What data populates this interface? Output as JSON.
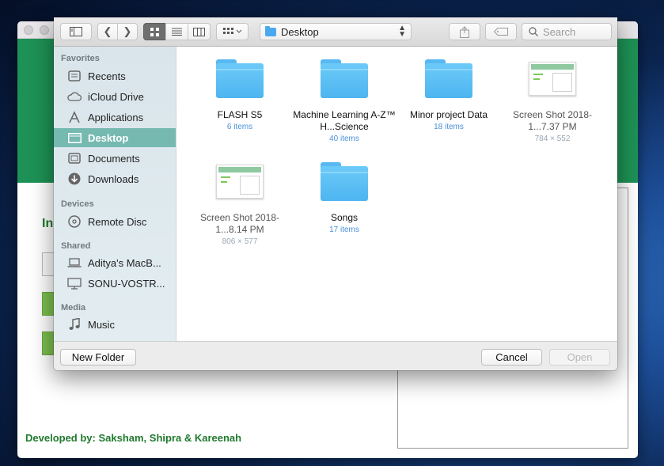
{
  "background_app": {
    "footer_text": "Developed by: Saksham, Shipra & Kareenah",
    "heading_fragment": "In"
  },
  "toolbar": {
    "sidebar_toggle_icon": "sidebar-icon",
    "back_icon": "chevron-left-icon",
    "forward_icon": "chevron-right-icon",
    "view_modes": [
      "icon-view",
      "list-view",
      "column-view"
    ],
    "selected_view": "icon-view",
    "arrange_icon": "group-icon",
    "location": "Desktop",
    "share_icon": "share-icon",
    "tag_icon": "tag-icon",
    "search_placeholder": "Search"
  },
  "sidebar": {
    "favorites_label": "Favorites",
    "favorites": [
      {
        "label": "Recents",
        "icon": "clock-icon"
      },
      {
        "label": "iCloud Drive",
        "icon": "cloud-icon"
      },
      {
        "label": "Applications",
        "icon": "applications-icon"
      },
      {
        "label": "Desktop",
        "icon": "desktop-icon",
        "selected": true
      },
      {
        "label": "Documents",
        "icon": "document-icon"
      },
      {
        "label": "Downloads",
        "icon": "download-icon"
      }
    ],
    "devices_label": "Devices",
    "devices": [
      {
        "label": "Remote Disc",
        "icon": "disc-icon"
      }
    ],
    "shared_label": "Shared",
    "shared": [
      {
        "label": "Aditya's MacB...",
        "icon": "laptop-icon"
      },
      {
        "label": "SONU-VOSTR...",
        "icon": "monitor-icon"
      }
    ],
    "media_label": "Media",
    "media": [
      {
        "label": "Music",
        "icon": "music-icon"
      }
    ]
  },
  "files": [
    {
      "name": "FLASH S5",
      "meta": "6 items",
      "kind": "folder"
    },
    {
      "name": "Machine Learning A-Z™ H...Science",
      "meta": "40 items",
      "kind": "folder"
    },
    {
      "name": "Minor project Data",
      "meta": "18 items",
      "kind": "folder"
    },
    {
      "name": "Screen Shot 2018-1...7.37 PM",
      "meta": "784 × 552",
      "kind": "image",
      "dimmed": true
    },
    {
      "name": "Screen Shot 2018-1...8.14 PM",
      "meta": "806 × 577",
      "kind": "image",
      "dimmed": true
    },
    {
      "name": "Songs",
      "meta": "17 items",
      "kind": "folder"
    }
  ],
  "buttons": {
    "new_folder": "New Folder",
    "cancel": "Cancel",
    "open": "Open"
  }
}
